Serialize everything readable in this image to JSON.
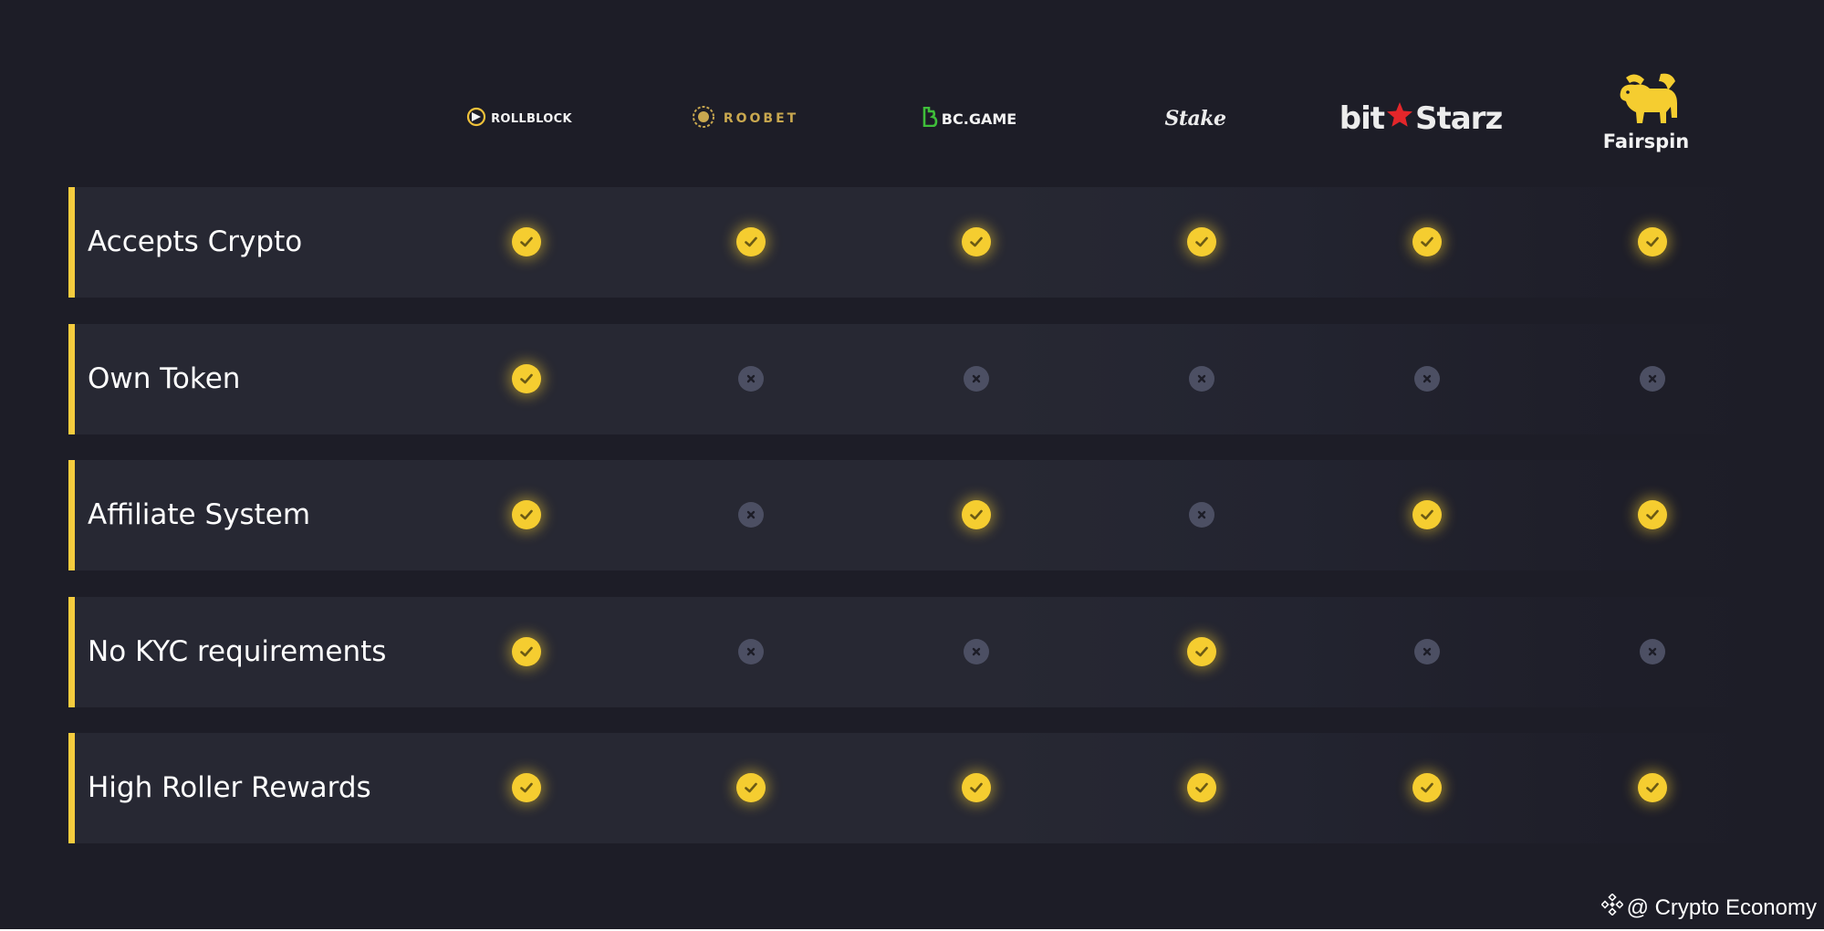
{
  "brands": [
    {
      "name": "ROLLBLOCK",
      "icon": "rollblock-logo-icon"
    },
    {
      "name": "ROOBET",
      "icon": "roobet-logo-icon"
    },
    {
      "name": "BC.GAME",
      "icon": "bcgame-logo-icon"
    },
    {
      "name": "Stake",
      "icon": null
    },
    {
      "name_left": "bit",
      "name_right": "Starz",
      "icon": "star-icon"
    },
    {
      "name": "Fairspin",
      "icon": "lion-logo-icon"
    }
  ],
  "features": [
    {
      "label": "Accepts Crypto",
      "values": [
        true,
        true,
        true,
        true,
        true,
        true
      ]
    },
    {
      "label": "Own Token",
      "values": [
        true,
        false,
        false,
        false,
        false,
        false
      ]
    },
    {
      "label": "Affiliate System",
      "values": [
        true,
        false,
        true,
        false,
        true,
        true
      ]
    },
    {
      "label": "No KYC requirements",
      "values": [
        true,
        false,
        false,
        true,
        false,
        false
      ]
    },
    {
      "label": "High Roller Rewards",
      "values": [
        true,
        true,
        true,
        true,
        true,
        true
      ]
    }
  ],
  "watermark": {
    "text": "@ Crypto Economy",
    "icon": "binance-diamond-icon"
  },
  "colors": {
    "background": "#1d1d27",
    "row": "#272833",
    "accent": "#f5cc3e",
    "check": "#f5cd30",
    "cross": "#4c4f63",
    "bitstarz_star": "#e3262a",
    "bcgame_green": "#3fbf3a",
    "roobet_gold": "#c9a84f"
  }
}
